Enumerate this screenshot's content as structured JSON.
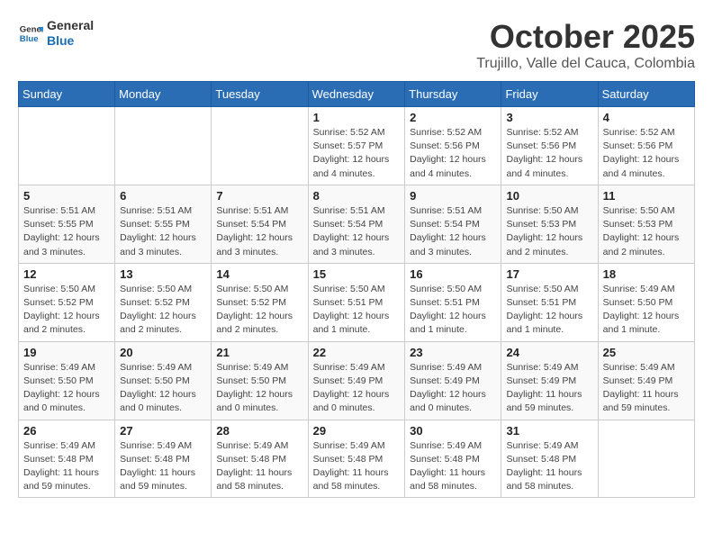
{
  "logo": {
    "line1": "General",
    "line2": "Blue"
  },
  "title": "October 2025",
  "location": "Trujillo, Valle del Cauca, Colombia",
  "weekdays": [
    "Sunday",
    "Monday",
    "Tuesday",
    "Wednesday",
    "Thursday",
    "Friday",
    "Saturday"
  ],
  "weeks": [
    [
      {
        "day": "",
        "info": ""
      },
      {
        "day": "",
        "info": ""
      },
      {
        "day": "",
        "info": ""
      },
      {
        "day": "1",
        "info": "Sunrise: 5:52 AM\nSunset: 5:57 PM\nDaylight: 12 hours\nand 4 minutes."
      },
      {
        "day": "2",
        "info": "Sunrise: 5:52 AM\nSunset: 5:56 PM\nDaylight: 12 hours\nand 4 minutes."
      },
      {
        "day": "3",
        "info": "Sunrise: 5:52 AM\nSunset: 5:56 PM\nDaylight: 12 hours\nand 4 minutes."
      },
      {
        "day": "4",
        "info": "Sunrise: 5:52 AM\nSunset: 5:56 PM\nDaylight: 12 hours\nand 4 minutes."
      }
    ],
    [
      {
        "day": "5",
        "info": "Sunrise: 5:51 AM\nSunset: 5:55 PM\nDaylight: 12 hours\nand 3 minutes."
      },
      {
        "day": "6",
        "info": "Sunrise: 5:51 AM\nSunset: 5:55 PM\nDaylight: 12 hours\nand 3 minutes."
      },
      {
        "day": "7",
        "info": "Sunrise: 5:51 AM\nSunset: 5:54 PM\nDaylight: 12 hours\nand 3 minutes."
      },
      {
        "day": "8",
        "info": "Sunrise: 5:51 AM\nSunset: 5:54 PM\nDaylight: 12 hours\nand 3 minutes."
      },
      {
        "day": "9",
        "info": "Sunrise: 5:51 AM\nSunset: 5:54 PM\nDaylight: 12 hours\nand 3 minutes."
      },
      {
        "day": "10",
        "info": "Sunrise: 5:50 AM\nSunset: 5:53 PM\nDaylight: 12 hours\nand 2 minutes."
      },
      {
        "day": "11",
        "info": "Sunrise: 5:50 AM\nSunset: 5:53 PM\nDaylight: 12 hours\nand 2 minutes."
      }
    ],
    [
      {
        "day": "12",
        "info": "Sunrise: 5:50 AM\nSunset: 5:52 PM\nDaylight: 12 hours\nand 2 minutes."
      },
      {
        "day": "13",
        "info": "Sunrise: 5:50 AM\nSunset: 5:52 PM\nDaylight: 12 hours\nand 2 minutes."
      },
      {
        "day": "14",
        "info": "Sunrise: 5:50 AM\nSunset: 5:52 PM\nDaylight: 12 hours\nand 2 minutes."
      },
      {
        "day": "15",
        "info": "Sunrise: 5:50 AM\nSunset: 5:51 PM\nDaylight: 12 hours\nand 1 minute."
      },
      {
        "day": "16",
        "info": "Sunrise: 5:50 AM\nSunset: 5:51 PM\nDaylight: 12 hours\nand 1 minute."
      },
      {
        "day": "17",
        "info": "Sunrise: 5:50 AM\nSunset: 5:51 PM\nDaylight: 12 hours\nand 1 minute."
      },
      {
        "day": "18",
        "info": "Sunrise: 5:49 AM\nSunset: 5:50 PM\nDaylight: 12 hours\nand 1 minute."
      }
    ],
    [
      {
        "day": "19",
        "info": "Sunrise: 5:49 AM\nSunset: 5:50 PM\nDaylight: 12 hours\nand 0 minutes."
      },
      {
        "day": "20",
        "info": "Sunrise: 5:49 AM\nSunset: 5:50 PM\nDaylight: 12 hours\nand 0 minutes."
      },
      {
        "day": "21",
        "info": "Sunrise: 5:49 AM\nSunset: 5:50 PM\nDaylight: 12 hours\nand 0 minutes."
      },
      {
        "day": "22",
        "info": "Sunrise: 5:49 AM\nSunset: 5:49 PM\nDaylight: 12 hours\nand 0 minutes."
      },
      {
        "day": "23",
        "info": "Sunrise: 5:49 AM\nSunset: 5:49 PM\nDaylight: 12 hours\nand 0 minutes."
      },
      {
        "day": "24",
        "info": "Sunrise: 5:49 AM\nSunset: 5:49 PM\nDaylight: 11 hours\nand 59 minutes."
      },
      {
        "day": "25",
        "info": "Sunrise: 5:49 AM\nSunset: 5:49 PM\nDaylight: 11 hours\nand 59 minutes."
      }
    ],
    [
      {
        "day": "26",
        "info": "Sunrise: 5:49 AM\nSunset: 5:48 PM\nDaylight: 11 hours\nand 59 minutes."
      },
      {
        "day": "27",
        "info": "Sunrise: 5:49 AM\nSunset: 5:48 PM\nDaylight: 11 hours\nand 59 minutes."
      },
      {
        "day": "28",
        "info": "Sunrise: 5:49 AM\nSunset: 5:48 PM\nDaylight: 11 hours\nand 58 minutes."
      },
      {
        "day": "29",
        "info": "Sunrise: 5:49 AM\nSunset: 5:48 PM\nDaylight: 11 hours\nand 58 minutes."
      },
      {
        "day": "30",
        "info": "Sunrise: 5:49 AM\nSunset: 5:48 PM\nDaylight: 11 hours\nand 58 minutes."
      },
      {
        "day": "31",
        "info": "Sunrise: 5:49 AM\nSunset: 5:48 PM\nDaylight: 11 hours\nand 58 minutes."
      },
      {
        "day": "",
        "info": ""
      }
    ]
  ]
}
